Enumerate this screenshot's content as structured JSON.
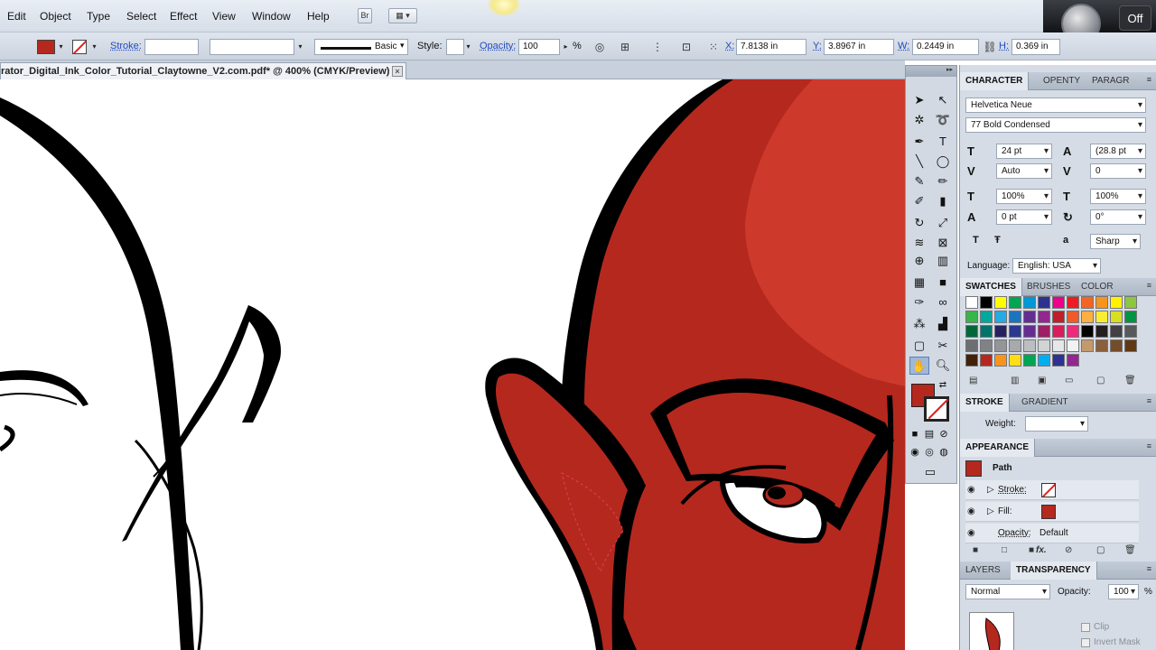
{
  "menu": {
    "items": [
      "Edit",
      "Object",
      "Type",
      "Select",
      "Effect",
      "View",
      "Window",
      "Help"
    ],
    "bridge_label": "Br",
    "mic_status": "Off"
  },
  "control_bar": {
    "stroke_label": "Stroke:",
    "brush_label": "Basic",
    "style_label": "Style:",
    "opacity_label": "Opacity:",
    "opacity_value": "100",
    "percent": "%",
    "x_label": "X:",
    "x_value": "7.8138 in",
    "y_label": "Y:",
    "y_value": "3.8967 in",
    "w_label": "W:",
    "w_value": "0.2449 in",
    "h_label": "H:",
    "h_value": "0.369 in",
    "fill_color": "#b5281e"
  },
  "document": {
    "tab_title": "rator_Digital_Ink_Color_Tutorial_Claytowne_V2.com.pdf* @ 400% (CMYK/Preview)",
    "close": "×"
  },
  "tools_panel": {
    "header": "▸▸",
    "fill_color": "#b5281e",
    "tools": [
      "selection-icon",
      "direct-selection-icon",
      "magic-wand-icon",
      "lasso-icon",
      "pen-icon",
      "type-icon",
      "line-icon",
      "ellipse-icon",
      "paintbrush-icon",
      "pencil-icon",
      "blob-brush-icon",
      "eraser-icon",
      "rotate-icon",
      "scale-icon",
      "warp-icon",
      "free-transform-icon",
      "shape-builder-icon",
      "perspective-icon",
      "mesh-icon",
      "gradient-icon",
      "eyedropper-icon",
      "blend-icon",
      "symbol-sprayer-icon",
      "graph-icon",
      "artboard-icon",
      "slice-icon",
      "hand-icon",
      "zoom-icon"
    ]
  },
  "character_panel": {
    "tabs": [
      "CHARACTER",
      "OPENTY",
      "PARAGR"
    ],
    "font_family": "Helvetica Neue",
    "font_style": "77 Bold Condensed",
    "font_size": "24 pt",
    "leading": "(28.8 pt",
    "kerning": "Auto",
    "tracking": "0",
    "vertical_scale": "100%",
    "horizontal_scale": "100%",
    "baseline_shift": "0 pt",
    "rotation": "0°",
    "antialias": "Sharp",
    "language_label": "Language:",
    "language": "English: USA"
  },
  "swatches_panel": {
    "tabs": [
      "SWATCHES",
      "BRUSHES",
      "COLOR"
    ],
    "colors": [
      "#ffffff",
      "#000000",
      "#ffff00",
      "#00a651",
      "#0099d8",
      "#2e3192",
      "#ec008c",
      "#ed1c24",
      "#f26522",
      "#f7941d",
      "#fff200",
      "#8dc63f",
      "#39b54a",
      "#00a99d",
      "#27aae1",
      "#1c75bc",
      "#662d91",
      "#92278f",
      "#be1e2d",
      "#f15a29",
      "#fbb040",
      "#f9ed32",
      "#d7df23",
      "#009444",
      "#006838",
      "#00746b",
      "#262262",
      "#2b388f",
      "#662d91",
      "#9e1f63",
      "#da1c5c",
      "#ee2a7b",
      "#000000",
      "#231f20",
      "#414042",
      "#58595b",
      "#6d6e71",
      "#808285",
      "#939598",
      "#a7a9ac",
      "#bcbec0",
      "#d1d3d4",
      "#e6e7e8",
      "#f1f2f2",
      "#c49a6c",
      "#8b5e3c",
      "#754c29",
      "#603913",
      "#42210b",
      "#b5281e",
      "#f7941d",
      "#ffde17",
      "#00a651",
      "#00aeef",
      "#2e3192",
      "#92278f"
    ]
  },
  "stroke_panel": {
    "tabs": [
      "STROKE",
      "GRADIENT"
    ],
    "weight_label": "Weight:"
  },
  "appearance_panel": {
    "title": "APPEARANCE",
    "object": "Path",
    "stroke_label": "Stroke:",
    "fill_label": "Fill:",
    "opacity_label": "Opacity:",
    "opacity_value": "Default",
    "fx": "fx."
  },
  "layers_panel": {
    "tabs": [
      "LAYERS",
      "TRANSPARENCY"
    ],
    "blend_mode": "Normal",
    "opacity_label": "Opacity:",
    "opacity_value": "100",
    "percent": "%",
    "clip_label": "Clip",
    "invert_mask_label": "Invert Mask"
  }
}
